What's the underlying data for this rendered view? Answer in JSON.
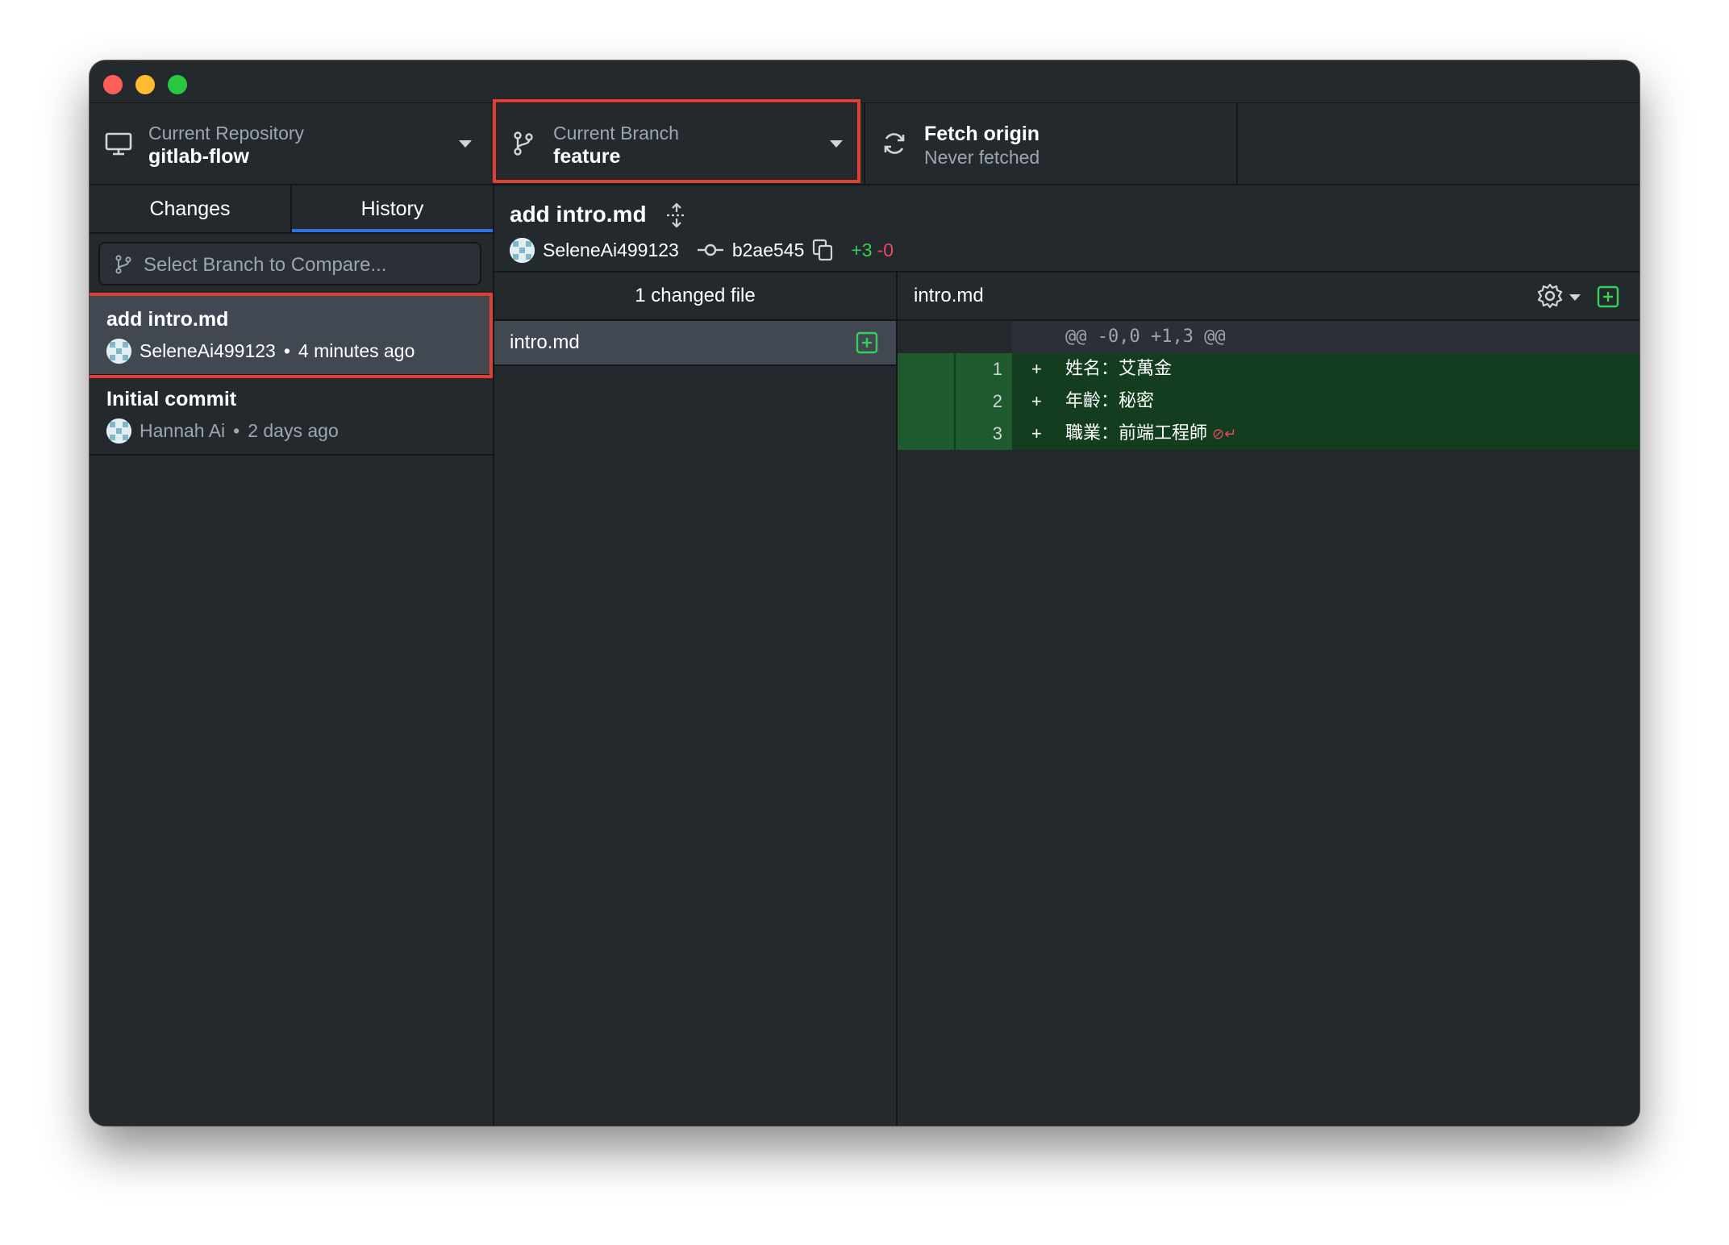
{
  "toolbar": {
    "repo": {
      "label": "Current Repository",
      "value": "gitlab-flow"
    },
    "branch": {
      "label": "Current Branch",
      "value": "feature"
    },
    "fetch": {
      "label": "Fetch origin",
      "sub": "Never fetched"
    }
  },
  "sidebar": {
    "tabs": [
      {
        "label": "Changes"
      },
      {
        "label": "History"
      }
    ],
    "active_tab": "History",
    "compare_placeholder": "Select Branch to Compare...",
    "commits": [
      {
        "title": "add intro.md",
        "author": "SeleneAi499123",
        "sep": "•",
        "time": "4 minutes ago",
        "selected": true
      },
      {
        "title": "Initial commit",
        "author": "Hannah Ai",
        "sep": "•",
        "time": "2 days ago",
        "selected": false
      }
    ]
  },
  "commit": {
    "title": "add intro.md",
    "author": "SeleneAi499123",
    "sha": "b2ae545",
    "additions": "+3",
    "deletions": "-0"
  },
  "files": {
    "header": "1 changed file",
    "items": [
      {
        "name": "intro.md",
        "status": "added"
      }
    ]
  },
  "diff": {
    "file": "intro.md",
    "hunk": "@@ -0,0 +1,3 @@",
    "lines": [
      {
        "num": "1",
        "sign": "+",
        "text": "姓名：艾萬金"
      },
      {
        "num": "2",
        "sign": "+",
        "text": "年齡：秘密"
      },
      {
        "num": "3",
        "sign": "+",
        "text": "職業：前端工程師"
      }
    ],
    "no_newline_marker": "⊘↵"
  },
  "colors": {
    "highlight": "#e0412f",
    "tab_underline": "#2f72e6",
    "added": "#34d058",
    "deleted": "#ea4a5a"
  }
}
